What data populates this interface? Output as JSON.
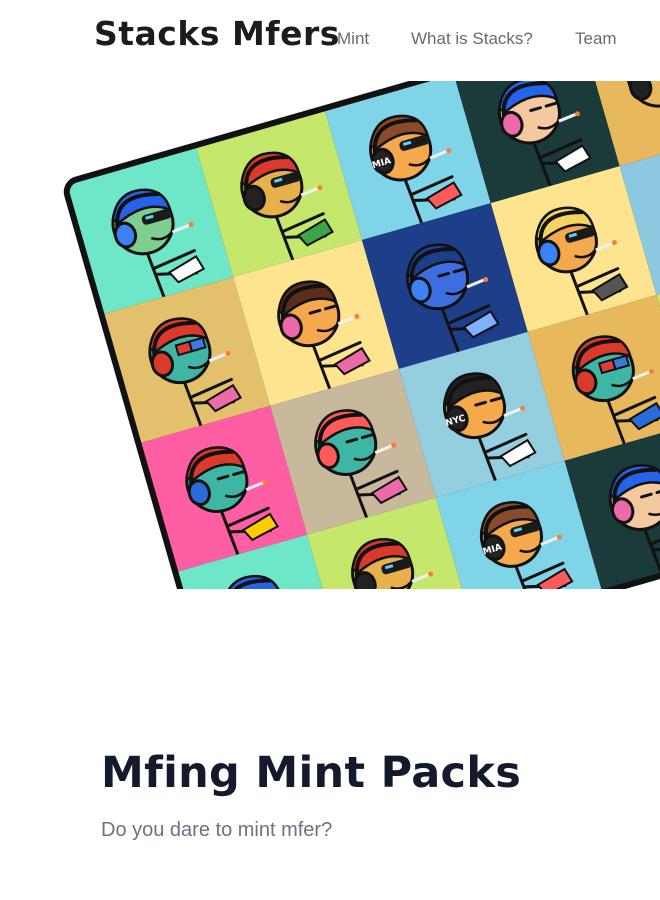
{
  "header": {
    "brand": "Stacks Mfers",
    "nav": {
      "mint": "Mint",
      "what_is_stacks": "What is Stacks?",
      "team": "Team"
    }
  },
  "hero": {
    "tiles": [
      {
        "bg": "#6ee7c8",
        "skin": "#7ecf8f",
        "hat": "#2563eb",
        "phones": "#3b82f6",
        "eyes": "shades",
        "accent": "#ffffff"
      },
      {
        "bg": "#c5e86c",
        "skin": "#e6b04a",
        "hat": "#d93a2b",
        "phones": "#222222",
        "eyes": "shades",
        "accent": "#3fa34d"
      },
      {
        "bg": "#7fd4e8",
        "skin": "#f3a94c",
        "hat": "#8a4b2a",
        "phones": "#222222",
        "eyes": "shades",
        "accent": "#ff5a5a",
        "label": "MIA"
      },
      {
        "bg": "#1b3a3a",
        "skin": "#f5c9a0",
        "hat": "#2563eb",
        "phones": "#ec6aa8",
        "eyes": "closed",
        "accent": "#ffffff"
      },
      {
        "bg": "#e7b95c",
        "skin": "#e7b95c",
        "hat": "#d93a2b",
        "phones": "#222222",
        "eyes": "3d",
        "accent": "#c23b2b"
      },
      {
        "bg": "#2a6a5a",
        "skin": "#7ecf8f",
        "hat": "#1b4d3e",
        "phones": "#222222",
        "eyes": "shades",
        "accent": "#ffffff"
      },
      {
        "bg": "#ffe27a",
        "skin": "#f3a94c",
        "hat": "#2563eb",
        "phones": "#222222",
        "eyes": "shades",
        "accent": "#ffcc00"
      },
      {
        "bg": "#e3c06b",
        "skin": "#3fb6a4",
        "hat": "#d93a2b",
        "phones": "#d93a2b",
        "eyes": "3d",
        "accent": "#ec6aa8"
      },
      {
        "bg": "#ffe490",
        "skin": "#f3a94c",
        "hat": "#5a2e1a",
        "phones": "#ec6aa8",
        "eyes": "closed",
        "accent": "#ec6aa8"
      },
      {
        "bg": "#1d3f8a",
        "skin": "#3d6ee0",
        "hat": "#1d3f8a",
        "phones": "#3b82f6",
        "eyes": "closed",
        "accent": "#7fb0ff"
      },
      {
        "bg": "#ffe490",
        "skin": "#f3a94c",
        "hat": "#f4d35e",
        "phones": "#3b82f6",
        "eyes": "shades",
        "accent": "#555555"
      },
      {
        "bg": "#8cc9e0",
        "skin": "#9a7b3a",
        "hat": "#ff7ab0",
        "phones": "#ffd400",
        "eyes": "closed",
        "accent": "#ff3b3b"
      },
      {
        "bg": "#ffd54a",
        "skin": "#3fb6a4",
        "hat": "#d93a2b",
        "phones": "#d93a2b",
        "eyes": "3d",
        "accent": "#2a6ad9"
      },
      {
        "bg": "#c5e86c",
        "skin": "#e6b04a",
        "hat": "#d93a2b",
        "phones": "#222222",
        "eyes": "shades",
        "accent": "#3fa34d"
      },
      {
        "bg": "#ff5fa2",
        "skin": "#3fb6a4",
        "hat": "#d93a2b",
        "phones": "#2a6ad9",
        "eyes": "closed",
        "accent": "#ffcc00"
      },
      {
        "bg": "#c9b99c",
        "skin": "#3fb6a4",
        "hat": "#ff5a5a",
        "phones": "#ff5a5a",
        "eyes": "closed",
        "accent": "#ec6aa8"
      },
      {
        "bg": "#94cfe0",
        "skin": "#f3a94c",
        "hat": "#222222",
        "phones": "#222222",
        "eyes": "closed",
        "accent": "#ffffff",
        "label": "NYC"
      },
      {
        "bg": "#e7b95c",
        "skin": "#3fb6a4",
        "hat": "#d93a2b",
        "phones": "#d93a2b",
        "eyes": "3d",
        "accent": "#2a6ad9"
      },
      {
        "bg": "#c5e86c",
        "skin": "#e6b04a",
        "hat": "#d93a2b",
        "phones": "#222222",
        "eyes": "shades",
        "accent": "#3fa34d"
      },
      {
        "bg": "#ffd54a",
        "skin": "#3fb6a4",
        "hat": "#d93a2b",
        "phones": "#d93a2b",
        "eyes": "3d",
        "accent": "#2a6ad9"
      },
      {
        "bg": "#ff9966",
        "skin": "#3fb6a4",
        "hat": "#d93a2b",
        "phones": "#222222",
        "eyes": "3d",
        "accent": "#2a6ad9"
      },
      {
        "bg": "#6ee7c8",
        "skin": "#7ecf8f",
        "hat": "#2563eb",
        "phones": "#3b82f6",
        "eyes": "shades",
        "accent": "#ffffff"
      },
      {
        "bg": "#c5e86c",
        "skin": "#e6b04a",
        "hat": "#d93a2b",
        "phones": "#222222",
        "eyes": "shades",
        "accent": "#3fa34d"
      },
      {
        "bg": "#7fd4e8",
        "skin": "#f3a94c",
        "hat": "#8a4b2a",
        "phones": "#222222",
        "eyes": "shades",
        "accent": "#ff5a5a",
        "label": "MIA"
      },
      {
        "bg": "#1b3a3a",
        "skin": "#f5c9a0",
        "hat": "#2563eb",
        "phones": "#ec6aa8",
        "eyes": "closed",
        "accent": "#ffffff"
      },
      {
        "bg": "#ffe27a",
        "skin": "#f3a94c",
        "hat": "#f4d35e",
        "phones": "#3b82f6",
        "eyes": "shades",
        "accent": "#555555"
      },
      {
        "bg": "#7d2fd0",
        "skin": "#e6b04a",
        "hat": "#d93a2b",
        "phones": "#222222",
        "eyes": "shades",
        "accent": "#3fa34d"
      },
      {
        "bg": "#e7b95c",
        "skin": "#3fb6a4",
        "hat": "#d93a2b",
        "phones": "#d93a2b",
        "eyes": "3d",
        "accent": "#2a6ad9"
      }
    ]
  },
  "section": {
    "title": "Mfing Mint Packs",
    "subtitle": "Do you dare to mint mfer?"
  }
}
